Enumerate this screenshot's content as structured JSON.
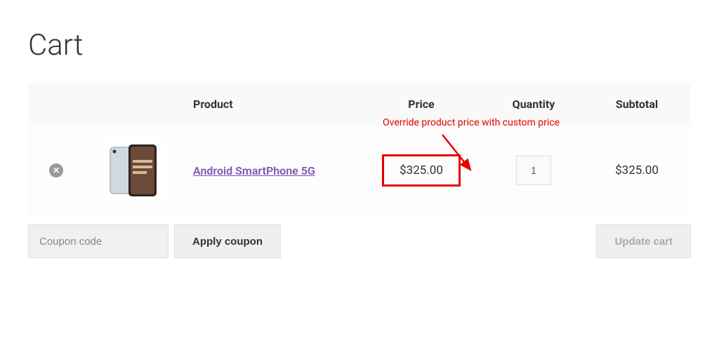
{
  "page": {
    "title": "Cart"
  },
  "table": {
    "headers": {
      "product": "Product",
      "price": "Price",
      "quantity": "Quantity",
      "subtotal": "Subtotal"
    }
  },
  "annotation": {
    "text": "Override product price with custom price"
  },
  "item": {
    "name": "Android SmartPhone 5G",
    "price": "$325.00",
    "quantity": "1",
    "subtotal": "$325.00"
  },
  "coupon": {
    "placeholder": "Coupon code",
    "apply_label": "Apply coupon"
  },
  "update_label": "Update cart"
}
